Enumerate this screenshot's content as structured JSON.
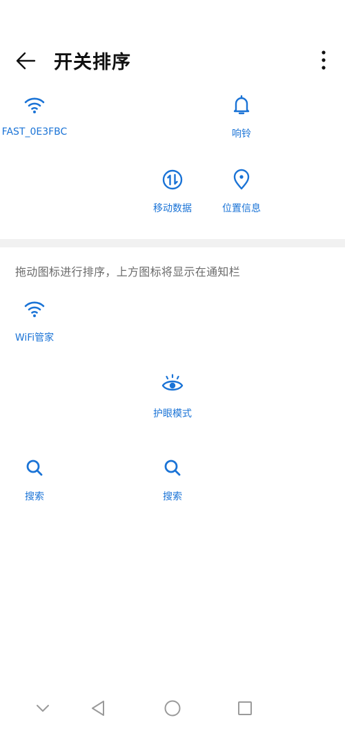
{
  "header": {
    "title": "开关排序",
    "back_icon": "arrow-left-icon",
    "more_icon": "more-vertical-icon"
  },
  "active_tiles": [
    {
      "label": "FAST_0E3FBC",
      "icon": "wifi-icon"
    },
    {
      "label": "响铃",
      "icon": "bell-icon"
    },
    {
      "label": "移动数据",
      "icon": "mobile-data-icon"
    },
    {
      "label": "位置信息",
      "icon": "location-pin-icon"
    }
  ],
  "hint": "拖动图标进行排序，上方图标将显示在通知栏",
  "inactive_tiles": [
    {
      "label": "WiFi管家",
      "icon": "wifi-icon"
    },
    {
      "label": "护眼模式",
      "icon": "eye-icon"
    },
    {
      "label": "搜索",
      "icon": "search-icon"
    },
    {
      "label": "搜索",
      "icon": "search-icon"
    }
  ],
  "navbar": {
    "icons": [
      "chevron-down-icon",
      "back-triangle-icon",
      "home-circle-icon",
      "recents-square-icon"
    ]
  },
  "colors": {
    "accent": "#1a73d6",
    "hint_text": "#6b6b6b",
    "divider": "#f1f1f1",
    "nav_icon": "#9a9a9a"
  }
}
